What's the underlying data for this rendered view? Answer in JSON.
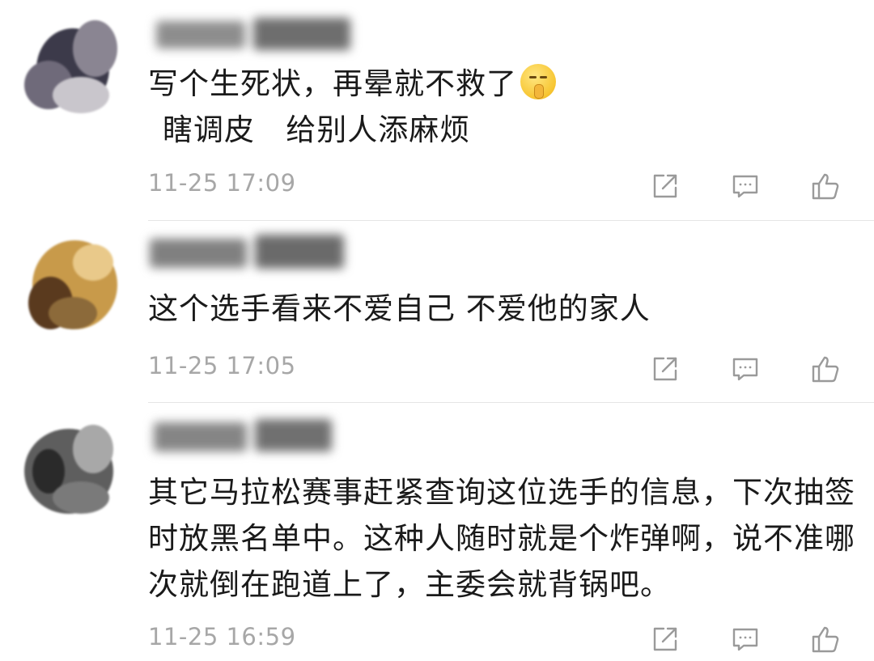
{
  "comments": [
    {
      "text_parts": [
        "写个生死状，再晕就不救了",
        "瞎调皮   给别人添麻烦"
      ],
      "emoji": "shushing-face-icon",
      "time": "11-25 17:09"
    },
    {
      "text": "这个选手看来不爱自己  不爱他的家人",
      "time": "11-25 17:05"
    },
    {
      "text": "其它马拉松赛事赶紧查询这位选手的信息，下次抽签时放黑名单中。这种人随时就是个炸弹啊，说不准哪次就倒在跑道上了，主委会就背锅吧。",
      "time": "11-25 16:59"
    }
  ],
  "icons": {
    "share": "share-icon",
    "reply": "comment-icon",
    "like": "thumbs-up-icon"
  },
  "colors": {
    "text": "#1a1a1a",
    "timestamp": "#a7a7a7",
    "icon": "#9a9a9a",
    "divider": "#e5e5e5"
  }
}
